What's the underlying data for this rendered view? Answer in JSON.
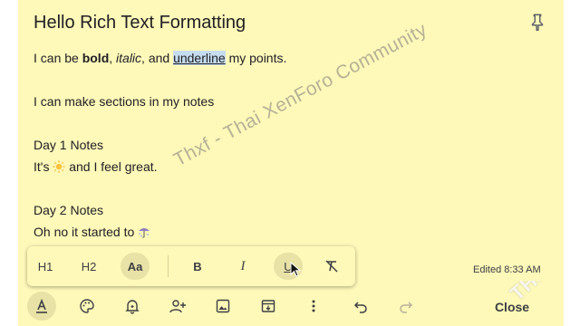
{
  "note": {
    "title": "Hello Rich Text Formatting",
    "line1": {
      "prefix": "I can be ",
      "bold": "bold",
      "sep1": ", ",
      "italic": "italic",
      "sep2": ", and ",
      "underline": "underline",
      "suffix": " my points."
    },
    "line2": "I can make sections in my notes",
    "day1_heading": "Day 1 Notes",
    "day1_line": {
      "prefix": "It's ",
      "emoji": "sun-icon",
      "suffix": " and I feel great."
    },
    "day2_heading": "Day 2 Notes",
    "day2_line": {
      "prefix": "Oh no it started to ",
      "emoji": "umbrella-rain-icon"
    }
  },
  "watermark": "Thxf - Thai XenForo Community",
  "corner_watermark": "THXF.ORG",
  "format_toolbar": {
    "h1": "H1",
    "h2": "H2",
    "normal": "Aa",
    "bold": "B",
    "italic": "I",
    "underline": "U",
    "clear_format": "clear-formatting-icon",
    "active": "normal"
  },
  "edited_text": "Edited 8:33 AM",
  "bottom_toolbar": {
    "icons": [
      "text-format-icon",
      "palette-icon",
      "reminder-bell-icon",
      "add-collaborator-icon",
      "image-icon",
      "archive-icon",
      "more-vert-icon",
      "undo-icon",
      "redo-icon"
    ],
    "close_label": "Close"
  },
  "colors": {
    "note_background": "#fef8b9",
    "highlight": "#c6dcef"
  }
}
